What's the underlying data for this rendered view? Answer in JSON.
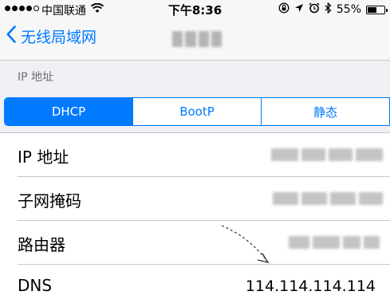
{
  "status_bar": {
    "carrier": "中国联通",
    "time": "下午8:36",
    "battery_percent": "55%",
    "battery_level": 0.55,
    "icons": [
      "signal-dots-icon",
      "wifi-icon",
      "orientation-lock-icon",
      "location-arrow-icon",
      "alarm-icon",
      "bluetooth-icon",
      "battery-icon"
    ]
  },
  "nav": {
    "back_label": "无线局域网",
    "title_obscured": true
  },
  "section": {
    "header": "IP 地址"
  },
  "segments": [
    {
      "label": "DHCP",
      "selected": true
    },
    {
      "label": "BootP",
      "selected": false
    },
    {
      "label": "静态",
      "selected": false
    }
  ],
  "rows": [
    {
      "label": "IP 地址",
      "value_obscured": true
    },
    {
      "label": "子网掩码",
      "value_obscured": true
    },
    {
      "label": "路由器",
      "value_obscured": true
    },
    {
      "label": "DNS",
      "value": "114.114.114.114"
    }
  ],
  "colors": {
    "accent": "#007aff",
    "background": "#efeff4",
    "separator": "#c8c7cc",
    "section_text": "#6d6d72"
  }
}
